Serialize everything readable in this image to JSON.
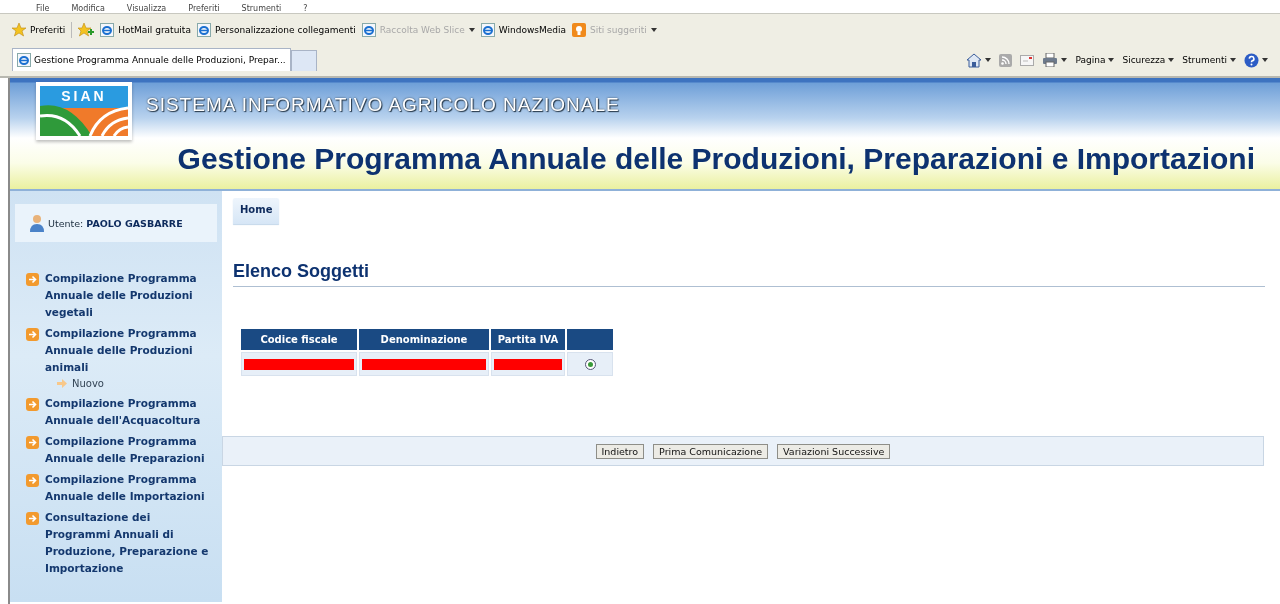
{
  "browser": {
    "menu": [
      "File",
      "Modifica",
      "Visualizza",
      "Preferiti",
      "Strumenti",
      "?"
    ],
    "favorites_label": "Preferiti",
    "links": [
      {
        "label": "HotMail gratuita",
        "kind": "ie",
        "disabled": false,
        "dropdown": false
      },
      {
        "label": "Personalizzazione collegamenti",
        "kind": "ie",
        "disabled": false,
        "dropdown": false
      },
      {
        "label": "Raccolta Web Slice",
        "kind": "ie",
        "disabled": true,
        "dropdown": true
      },
      {
        "label": "WindowsMedia",
        "kind": "ie",
        "disabled": false,
        "dropdown": false
      },
      {
        "label": "Siti suggeriti",
        "kind": "suggested",
        "disabled": true,
        "dropdown": true
      }
    ],
    "tabs": [
      {
        "title": "Gestione Programma Annuale delle Produzioni, Prepar...",
        "selected": true
      }
    ],
    "commands": [
      "Pagina",
      "Sicurezza",
      "Strumenti"
    ]
  },
  "header": {
    "logo": "SIAN",
    "subtitle": "SISTEMA INFORMATIVO AGRICOLO NAZIONALE",
    "title": "Gestione Programma Annuale delle Produzioni, Preparazioni e Importazioni"
  },
  "user": {
    "label": "Utente:",
    "name": "PAOLO GASBARRE"
  },
  "sidebar": {
    "items": [
      {
        "label": "Compilazione Programma Annuale delle Produzioni vegetali"
      },
      {
        "label": "Compilazione Programma Annuale delle Produzioni animali",
        "children": [
          {
            "label": "Nuovo"
          }
        ]
      },
      {
        "label": "Compilazione Programma Annuale dell'Acquacoltura"
      },
      {
        "label": "Compilazione Programma Annuale delle Preparazioni"
      },
      {
        "label": "Compilazione Programma Annuale delle Importazioni"
      },
      {
        "label": "Consultazione dei Programmi Annuali di Produzione, Preparazione e Importazione"
      }
    ]
  },
  "breadcrumb": [
    "Home"
  ],
  "page_title": "Elenco Soggetti",
  "table": {
    "columns": [
      "Codice fiscale",
      "Denominazione",
      "Partita IVA"
    ],
    "rows": [
      {
        "cells": [
          {
            "redacted": true
          },
          {
            "redacted": true
          },
          {
            "redacted": true
          }
        ],
        "selected": true
      }
    ]
  },
  "buttons": [
    "Indietro",
    "Prima Comunicazione",
    "Variazioni Successive"
  ]
}
